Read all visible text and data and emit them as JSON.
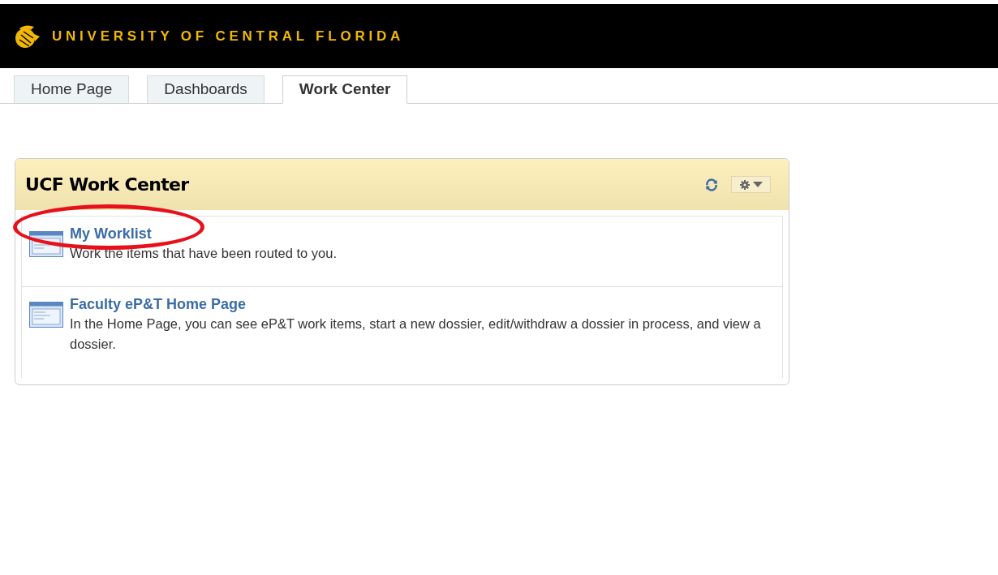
{
  "banner": {
    "title": "UNIVERSITY OF CENTRAL FLORIDA"
  },
  "tabs": [
    {
      "label": "Home Page",
      "selected": false
    },
    {
      "label": "Dashboards",
      "selected": false
    },
    {
      "label": "Work Center",
      "selected": true
    }
  ],
  "panel": {
    "title": "UCF Work Center",
    "items": [
      {
        "title": "My Worklist",
        "description": "Work the items that have been routed to you.",
        "highlighted": true
      },
      {
        "title": "Faculty eP&T Home Page",
        "description": "In the Home Page, you can see eP&T work items, start a new dossier, edit/withdraw a dossier in process, and view a dossier.",
        "highlighted": false
      }
    ]
  }
}
